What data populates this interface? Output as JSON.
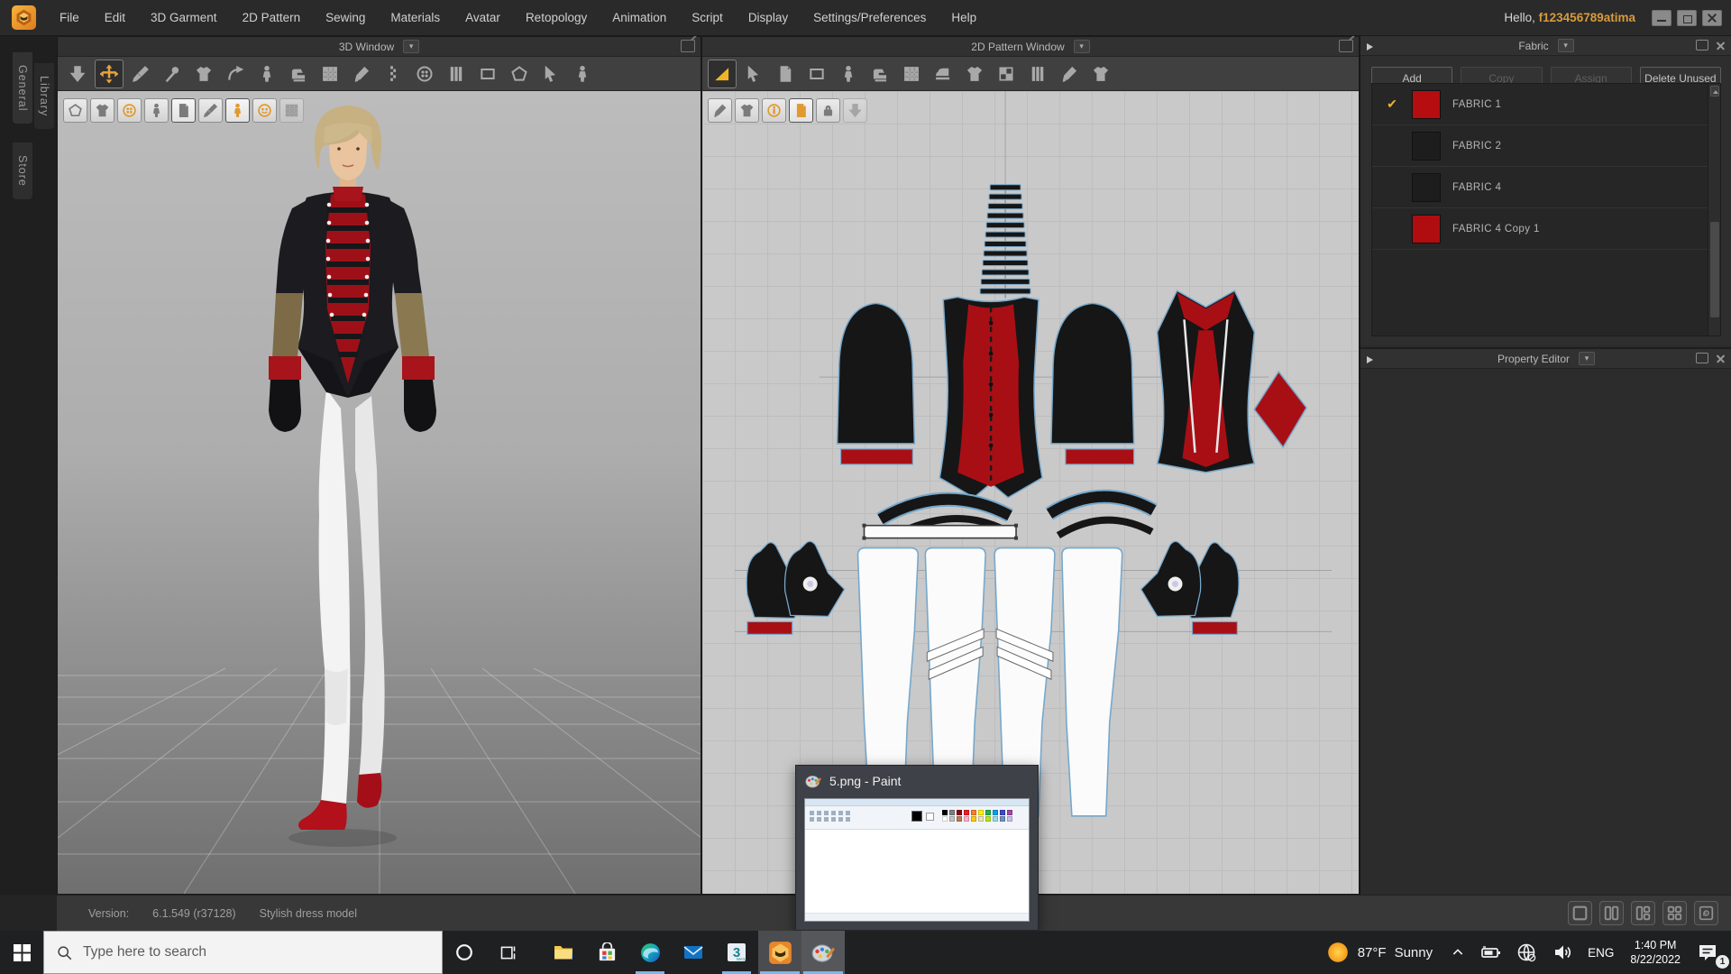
{
  "app": {
    "hello_prefix": "Hello, ",
    "username": "f123456789atima",
    "menus": [
      "File",
      "Edit",
      "3D Garment",
      "2D Pattern",
      "Sewing",
      "Materials",
      "Avatar",
      "Retopology",
      "Animation",
      "Script",
      "Display",
      "Settings/Preferences",
      "Help"
    ]
  },
  "side_tabs": {
    "general": "General",
    "library": "Library",
    "store": "Store"
  },
  "viewport3d": {
    "title": "3D Window"
  },
  "viewport2d": {
    "title": "2D Pattern Window"
  },
  "icons": {
    "dropdown_glyph": "▾"
  },
  "fabric": {
    "title": "Fabric",
    "add": "Add",
    "add_enabled": true,
    "copy": "Copy",
    "copy_enabled": false,
    "assign": "Assign",
    "assign_enabled": false,
    "delete_unused": "Delete Unused",
    "delete_enabled": true,
    "items": [
      {
        "name": "FABRIC 1",
        "color": "#b60d10",
        "check": "✔"
      },
      {
        "name": "FABRIC 2",
        "color": "#1d1d1d",
        "check": ""
      },
      {
        "name": "FABRIC 4",
        "color": "#1d1d1d",
        "check": ""
      },
      {
        "name": "FABRIC 4 Copy 1",
        "color": "#b00d10",
        "check": ""
      }
    ]
  },
  "property_editor": {
    "title": "Property Editor"
  },
  "statusbar": {
    "version_label": "Version:",
    "version_value": "6.1.549 (r37128)",
    "model_name": "Stylish dress model"
  },
  "paint_preview": {
    "title": "5.png - Paint",
    "palette": [
      "#000000",
      "#7f7f7f",
      "#880015",
      "#ed1c24",
      "#ff7f27",
      "#fff200",
      "#22b14c",
      "#00a2e8",
      "#3f48cc",
      "#a349a4",
      "#ffffff",
      "#c3c3c3",
      "#b97a57",
      "#ffaec9",
      "#ffc90e",
      "#efe4b0",
      "#b5e61d",
      "#99d9ea",
      "#7092be",
      "#c8bfe7"
    ]
  },
  "taskbar": {
    "search_placeholder": "Type here to search",
    "weather": {
      "temp": "87°F",
      "condition": "Sunny"
    },
    "language": "ENG",
    "clock": {
      "time": "1:40 PM",
      "date": "8/22/2022"
    },
    "notification_count": "1"
  },
  "colors": {
    "accent_orange": "#e8a33b",
    "fabric_red": "#b60d10",
    "taskbar_underline": "#76b9ed"
  }
}
